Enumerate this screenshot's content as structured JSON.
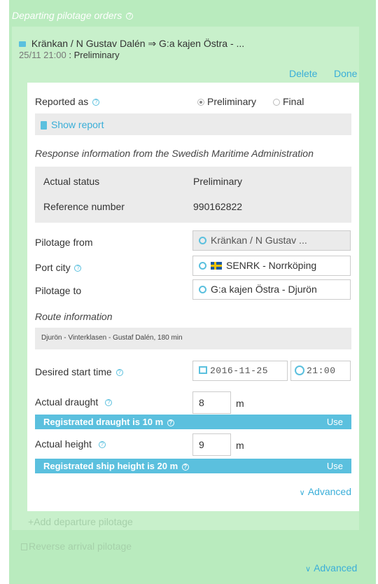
{
  "section_title": "Departing pilotage orders",
  "order": {
    "route": "Kränkan / N Gustav Dalén ⇒ G:a kajen Östra - ...",
    "date": "25/11 21:00",
    "status_sep": " : ",
    "status": "Preliminary",
    "delete_label": "Delete",
    "done_label": "Done"
  },
  "reported": {
    "label": "Reported as",
    "option_preliminary": "Preliminary",
    "option_final": "Final",
    "selected": "Preliminary"
  },
  "show_report_label": "Show report",
  "response": {
    "heading": "Response information from the Swedish Maritime Administration",
    "actual_status_label": "Actual status",
    "actual_status_value": "Preliminary",
    "reference_label": "Reference number",
    "reference_value": "990162822"
  },
  "pilotage_from": {
    "label": "Pilotage from",
    "value": "Kränkan / N Gustav ..."
  },
  "port_city": {
    "label": "Port city",
    "value": "SENRK - Norrköping"
  },
  "pilotage_to": {
    "label": "Pilotage to",
    "value": "G:a kajen Östra - Djurön"
  },
  "route_info": {
    "heading": "Route information",
    "value": "Djurön - Vinterklasen - Gustaf Dalén, 180 min"
  },
  "start_time": {
    "label": "Desired start time",
    "date": "2016-11-25",
    "time": "21:00"
  },
  "draught": {
    "label": "Actual draught",
    "value": "8",
    "unit": "m",
    "registered_text": "Registrated draught is 10 m",
    "use_label": "Use"
  },
  "height": {
    "label": "Actual height",
    "value": "9",
    "unit": "m",
    "registered_text": "Registrated ship height is 20 m",
    "use_label": "Use"
  },
  "advanced_inner_label": "Advanced",
  "add_departure_label": "+Add departure pilotage",
  "reverse_arrival_label": "Reverse arrival pilotage",
  "advanced_outer_label": "Advanced",
  "colors": {
    "outer_bg": "#b9ebbe",
    "inner_bg": "#c8f0cb",
    "accent": "#5bc0de",
    "link": "#3aaed8"
  }
}
